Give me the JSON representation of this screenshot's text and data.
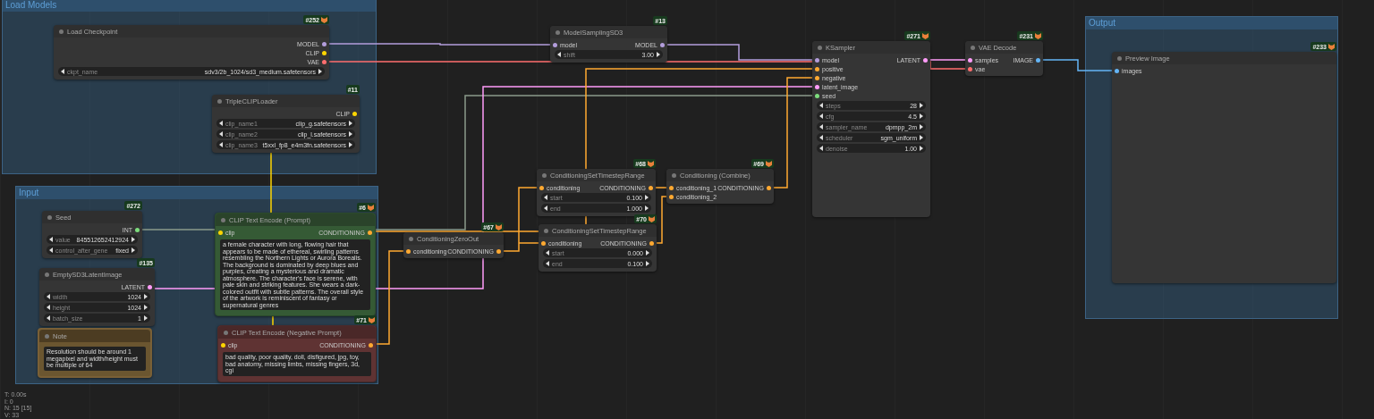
{
  "groups": [
    {
      "title": "Load Models"
    },
    {
      "title": "Input"
    },
    {
      "title": "Output"
    }
  ],
  "nodes": [
    {
      "badge": "#252",
      "badge_icon": true,
      "title": "Load Checkpoint",
      "kind": "default",
      "outputs": [
        {
          "name": "MODEL",
          "color": "#b39ddb"
        },
        {
          "name": "CLIP",
          "color": "#ffd500"
        },
        {
          "name": "VAE",
          "color": "#ff6e6e"
        }
      ],
      "widgets": [
        {
          "name": "ckpt_name",
          "value": "sdv3/2b_1024/sd3_medium.safetensors"
        }
      ]
    },
    {
      "badge": "#11",
      "badge_icon": false,
      "title": "TripleCLIPLoader",
      "kind": "default",
      "outputs": [
        {
          "name": "CLIP",
          "color": "#ffd500"
        }
      ],
      "widgets": [
        {
          "name": "clip_name1",
          "value": "clip_g.safetensors"
        },
        {
          "name": "clip_name2",
          "value": "clip_l.safetensors"
        },
        {
          "name": "clip_name3",
          "value": "t5xxl_fp8_e4m3fn.safetensors"
        }
      ]
    },
    {
      "badge": "#272",
      "badge_icon": false,
      "title": "Seed",
      "kind": "default",
      "outputs": [
        {
          "name": "INT",
          "color": "#7ddc7d"
        }
      ],
      "widgets": [
        {
          "name": "value",
          "value": "845512652412924"
        },
        {
          "name": "control_after_gene",
          "value": "fixed"
        }
      ]
    },
    {
      "badge": "#135",
      "badge_icon": false,
      "title": "EmptySD3LatentImage",
      "kind": "default",
      "outputs": [
        {
          "name": "LATENT",
          "color": "#ff9cf9"
        }
      ],
      "widgets": [
        {
          "name": "width",
          "value": "1024"
        },
        {
          "name": "height",
          "value": "1024"
        },
        {
          "name": "batch_size",
          "value": "1"
        }
      ]
    },
    {
      "title": "Note",
      "kind": "note",
      "text": "Resolution should be around 1 megapixel and width/height must be multiple of 64"
    },
    {
      "badge": "#6",
      "badge_icon": true,
      "title": "CLIP Text Encode (Prompt)",
      "kind": "positive",
      "inputs": [
        {
          "name": "clip",
          "color": "#ffd500"
        }
      ],
      "outputs": [
        {
          "name": "CONDITIONING",
          "color": "#ffa931"
        }
      ],
      "text": "a female character with long, flowing hair that appears to be made of ethereal, swirling patterns resembling the Northern Lights or Aurora Borealis. The background is dominated by deep blues and purples, creating a mysterious and dramatic atmosphere. The character's face is serene, with pale skin and striking features. She wears a dark-colored outfit with subtle patterns. The overall style of the artwork is reminiscent of fantasy or supernatural genres"
    },
    {
      "badge": "#71",
      "badge_icon": true,
      "title": "CLIP Text Encode (Negative Prompt)",
      "kind": "negative",
      "inputs": [
        {
          "name": "clip",
          "color": "#ffd500"
        }
      ],
      "outputs": [
        {
          "name": "CONDITIONING",
          "color": "#ffa931"
        }
      ],
      "text": "bad quality, poor quality, doll, disfigured, jpg, toy, bad anatomy, missing limbs, missing fingers, 3d, cgi"
    },
    {
      "badge": "#13",
      "badge_icon": false,
      "title": "ModelSamplingSD3",
      "kind": "default",
      "inputs": [
        {
          "name": "model",
          "color": "#b39ddb"
        }
      ],
      "outputs": [
        {
          "name": "MODEL",
          "color": "#b39ddb"
        }
      ],
      "widgets": [
        {
          "name": "shift",
          "value": "3.00"
        }
      ]
    },
    {
      "badge": "#67",
      "badge_icon": true,
      "title": "ConditioningZeroOut",
      "kind": "default",
      "inputs": [
        {
          "name": "conditioning",
          "color": "#ffa931"
        }
      ],
      "outputs": [
        {
          "name": "CONDITIONING",
          "color": "#ffa931"
        }
      ]
    },
    {
      "badge": "#68",
      "badge_icon": true,
      "title": "ConditioningSetTimestepRange",
      "kind": "default",
      "inputs": [
        {
          "name": "conditioning",
          "color": "#ffa931"
        }
      ],
      "outputs": [
        {
          "name": "CONDITIONING",
          "color": "#ffa931"
        }
      ],
      "widgets": [
        {
          "name": "start",
          "value": "0.100"
        },
        {
          "name": "end",
          "value": "1.000"
        }
      ]
    },
    {
      "badge": "#70",
      "badge_icon": true,
      "title": "ConditioningSetTimestepRange",
      "kind": "default",
      "inputs": [
        {
          "name": "conditioning",
          "color": "#ffa931"
        }
      ],
      "outputs": [
        {
          "name": "CONDITIONING",
          "color": "#ffa931"
        }
      ],
      "widgets": [
        {
          "name": "start",
          "value": "0.000"
        },
        {
          "name": "end",
          "value": "0.100"
        }
      ]
    },
    {
      "badge": "#69",
      "badge_icon": true,
      "title": "Conditioning (Combine)",
      "kind": "default",
      "inputs": [
        {
          "name": "conditioning_1",
          "color": "#ffa931"
        },
        {
          "name": "conditioning_2",
          "color": "#ffa931"
        }
      ],
      "outputs": [
        {
          "name": "CONDITIONING",
          "color": "#ffa931"
        }
      ]
    },
    {
      "badge": "#271",
      "badge_icon": true,
      "title": "KSampler",
      "kind": "default",
      "inputs": [
        {
          "name": "model",
          "color": "#b39ddb"
        },
        {
          "name": "positive",
          "color": "#ffa931"
        },
        {
          "name": "negative",
          "color": "#ffa931"
        },
        {
          "name": "latent_image",
          "color": "#ff9cf9"
        },
        {
          "name": "seed",
          "color": "#7ddc7d"
        }
      ],
      "outputs": [
        {
          "name": "LATENT",
          "color": "#ff9cf9"
        }
      ],
      "widgets": [
        {
          "name": "steps",
          "value": "28"
        },
        {
          "name": "cfg",
          "value": "4.5"
        },
        {
          "name": "sampler_name",
          "value": "dpmpp_2m"
        },
        {
          "name": "scheduler",
          "value": "sgm_uniform"
        },
        {
          "name": "denoise",
          "value": "1.00"
        }
      ]
    },
    {
      "badge": "#231",
      "badge_icon": true,
      "title": "VAE Decode",
      "kind": "default",
      "inputs": [
        {
          "name": "samples",
          "color": "#ff9cf9"
        },
        {
          "name": "vae",
          "color": "#ff6e6e"
        }
      ],
      "outputs": [
        {
          "name": "IMAGE",
          "color": "#64b5f6"
        }
      ]
    },
    {
      "badge": "#233",
      "badge_icon": true,
      "title": "Preview Image",
      "kind": "default",
      "inputs": [
        {
          "name": "images",
          "color": "#64b5f6"
        }
      ]
    }
  ],
  "stats": [
    "T: 0.00s",
    "I: 0",
    "N: 15 [15]",
    "V: 33"
  ]
}
